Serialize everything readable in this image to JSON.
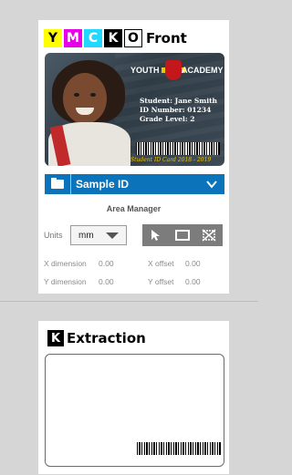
{
  "front": {
    "channels": [
      "Y",
      "M",
      "C",
      "K",
      "O"
    ],
    "title": "Front",
    "card": {
      "academy_left": "YOUTH",
      "academy_right": "ACADEMY",
      "student_line": "Student: Jane Smith",
      "id_line": "ID Number: 01234",
      "grade_line": "Grade Level: 2",
      "footer": "Student ID Card 2018 - 2019"
    },
    "sample": {
      "label": "Sample ID"
    },
    "area_manager": {
      "title": "Area Manager",
      "units_label": "Units",
      "units_value": "mm",
      "x_dimension_label": "X dimension",
      "x_dimension_value": "0.00",
      "y_dimension_label": "Y dimension",
      "y_dimension_value": "0.00",
      "x_offset_label": "X offset",
      "x_offset_value": "0.00",
      "y_offset_label": "Y offset",
      "y_offset_value": "0.00"
    }
  },
  "extraction": {
    "channel": "K",
    "title": "Extraction"
  },
  "colors": {
    "accent": "#0a73b9",
    "yellow": "#ffff00",
    "magenta": "#e800e8",
    "cyan": "#22d8ff",
    "black": "#000000"
  }
}
